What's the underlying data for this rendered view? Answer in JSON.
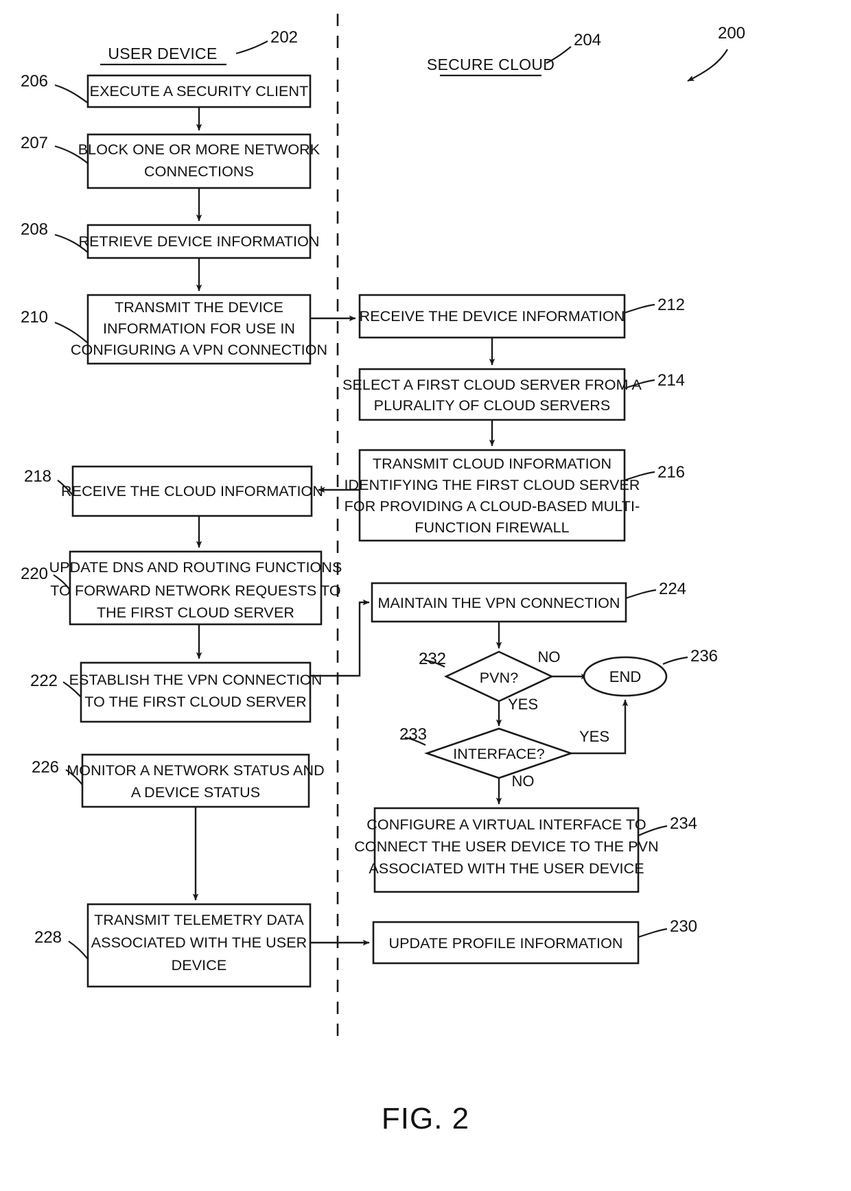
{
  "figure": {
    "caption": "FIG. 2",
    "figure_ref": "200"
  },
  "lanes": [
    {
      "title": "USER DEVICE",
      "ref": "202"
    },
    {
      "title": "SECURE CLOUD",
      "ref": "204"
    }
  ],
  "nodes": {
    "n206": {
      "ref": "206",
      "lines": [
        "EXECUTE A SECURITY CLIENT"
      ]
    },
    "n207": {
      "ref": "207",
      "lines": [
        "BLOCK ONE OR MORE NETWORK",
        "CONNECTIONS"
      ]
    },
    "n208": {
      "ref": "208",
      "lines": [
        "RETRIEVE DEVICE INFORMATION"
      ]
    },
    "n210": {
      "ref": "210",
      "lines": [
        "TRANSMIT THE DEVICE",
        "INFORMATION FOR USE IN",
        "CONFIGURING A VPN CONNECTION"
      ]
    },
    "n212": {
      "ref": "212",
      "lines": [
        "RECEIVE THE DEVICE INFORMATION"
      ]
    },
    "n214": {
      "ref": "214",
      "lines": [
        "SELECT A FIRST CLOUD SERVER FROM A",
        "PLURALITY OF CLOUD SERVERS"
      ]
    },
    "n216": {
      "ref": "216",
      "lines": [
        "TRANSMIT CLOUD INFORMATION",
        "IDENTIFYING THE FIRST CLOUD SERVER",
        "FOR PROVIDING A CLOUD-BASED MULTI-",
        "FUNCTION FIREWALL"
      ]
    },
    "n218": {
      "ref": "218",
      "lines": [
        "RECEIVE THE CLOUD INFORMATION"
      ]
    },
    "n220": {
      "ref": "220",
      "lines": [
        "UPDATE DNS AND ROUTING FUNCTIONS",
        "TO FORWARD NETWORK REQUESTS TO",
        "THE FIRST CLOUD SERVER"
      ]
    },
    "n222": {
      "ref": "222",
      "lines": [
        "ESTABLISH THE VPN CONNECTION",
        "TO THE FIRST CLOUD SERVER"
      ]
    },
    "n224": {
      "ref": "224",
      "lines": [
        "MAINTAIN THE VPN CONNECTION"
      ]
    },
    "n226": {
      "ref": "226",
      "lines": [
        "MONITOR A NETWORK STATUS AND",
        "A DEVICE STATUS"
      ]
    },
    "n228": {
      "ref": "228",
      "lines": [
        "TRANSMIT TELEMETRY DATA",
        "ASSOCIATED WITH THE USER",
        "DEVICE"
      ]
    },
    "n230": {
      "ref": "230",
      "lines": [
        "UPDATE PROFILE INFORMATION"
      ]
    },
    "n232": {
      "ref": "232",
      "lines": [
        "PVN?"
      ]
    },
    "n233": {
      "ref": "233",
      "lines": [
        "INTERFACE?"
      ]
    },
    "n234": {
      "ref": "234",
      "lines": [
        "CONFIGURE A VIRTUAL INTERFACE TO",
        "CONNECT THE USER DEVICE TO THE PVN",
        "ASSOCIATED WITH THE USER DEVICE"
      ]
    },
    "n236": {
      "ref": "236",
      "lines": [
        "END"
      ]
    }
  },
  "edge_labels": {
    "pvn_no": "NO",
    "pvn_yes": "YES",
    "interface_yes": "YES",
    "interface_no": "NO"
  },
  "colors": {
    "ink": "#111111",
    "stroke": "#1a1a1a",
    "background": "#ffffff"
  }
}
